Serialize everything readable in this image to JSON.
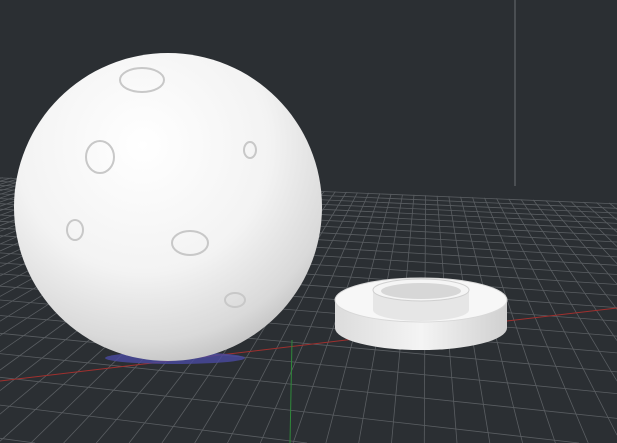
{
  "viewport": {
    "background_color": "#2b2f33",
    "grid_color": "#5a5e62",
    "x_axis_color": "#a0302e",
    "y_axis_color": "#2f8a3a",
    "model_color": "#f2f2f2",
    "objects": [
      {
        "name": "moon-sphere-model"
      },
      {
        "name": "ring-base-model"
      }
    ]
  }
}
